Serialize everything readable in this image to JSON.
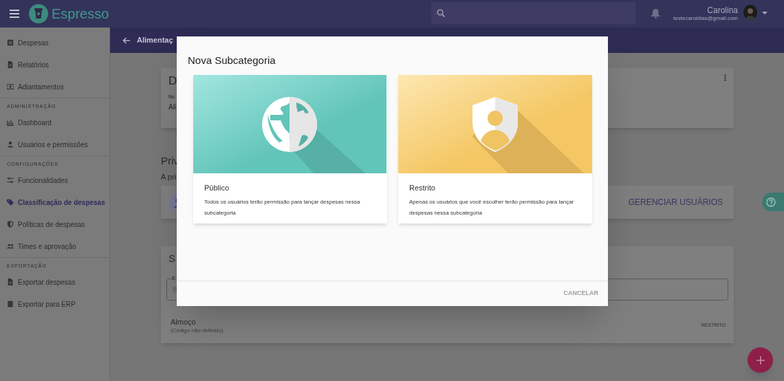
{
  "app": {
    "name": "Espresso"
  },
  "user": {
    "name": "Carolina",
    "email": "testecaroldias@gmail.com"
  },
  "sidebar": {
    "sections": [
      {
        "items": [
          {
            "label": "Despesas",
            "selected": false
          },
          {
            "label": "Relatórios",
            "selected": false
          },
          {
            "label": "Adiantamentos",
            "selected": false
          }
        ]
      },
      {
        "title": "ADMINISTRAÇÃO",
        "items": [
          {
            "label": "Dashboard",
            "selected": false
          },
          {
            "label": "Usuários e permissões",
            "selected": false
          }
        ]
      },
      {
        "title": "CONFIGURAÇÕES",
        "items": [
          {
            "label": "Funcionalidades",
            "selected": false
          },
          {
            "label": "Classificação de despesas",
            "selected": true
          },
          {
            "label": "Políticas de despesas",
            "selected": false
          },
          {
            "label": "Times e aprovação",
            "selected": false
          }
        ]
      },
      {
        "title": "EXPORTAÇÃO",
        "items": [
          {
            "label": "Exportar despesas",
            "selected": false
          },
          {
            "label": "Exportar para ERP",
            "selected": false
          }
        ]
      }
    ]
  },
  "page": {
    "title": "Alimentaç",
    "details_card": {
      "title": "D",
      "field_label": "No",
      "field_value": "Ali"
    },
    "privacy": {
      "title": "Priv",
      "text": "A pri",
      "action": "GERENCIAR USUÁRIOS"
    },
    "subcategories_card": {
      "title": "S",
      "search": {
        "label": "E",
        "placeholder": "B"
      },
      "rows": [
        {
          "name": "Almoço",
          "code": "(Código não definido)",
          "access": "RESTRITO"
        }
      ]
    }
  },
  "dialog": {
    "title": "Nova Subcategoria",
    "options": [
      {
        "kind": "public",
        "title": "Público",
        "description": "Todos os usuários terão permissão para lançar despesas nessa subcategoria"
      },
      {
        "kind": "restricted",
        "title": "Restrito",
        "description": "Apenas os usuários que você escolher terão permissão para lançar despesas nessa subcategoria"
      }
    ],
    "buttons": [
      "CANCELAR"
    ]
  }
}
